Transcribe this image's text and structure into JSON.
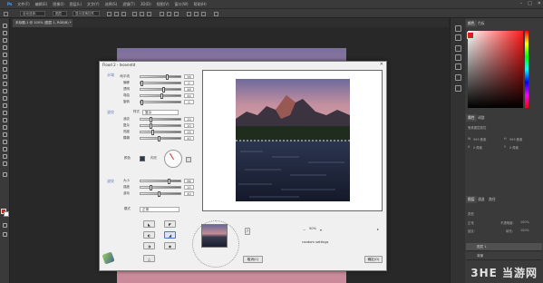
{
  "menubar": {
    "items": [
      "文件(F)",
      "编辑(E)",
      "图像(I)",
      "图层(L)",
      "文字(Y)",
      "选择(S)",
      "滤镜(T)",
      "3D(D)",
      "视图(V)",
      "窗口(W)",
      "帮助(H)"
    ]
  },
  "options": {
    "auto_select": "自动选择:",
    "layer_select": "图层",
    "show_transform": "显示变换控件"
  },
  "document": {
    "tab_title": "未标题-1 @ 100% (图层 1, RGB/8) *"
  },
  "dialog": {
    "title": "Flood 2 - Inoventd",
    "section_horizon": "水域",
    "section_waves": "波纹",
    "section_ripple": "波纹",
    "params_top": [
      {
        "label": "地平线",
        "value": "56"
      },
      {
        "label": "偏移",
        "value": "0"
      },
      {
        "label": "透明",
        "value": "46"
      },
      {
        "label": "弯曲",
        "value": "44"
      },
      {
        "label": "旋转",
        "value": "0"
      }
    ],
    "waves_mode_label": "样式",
    "waves_mode_value": "复杂",
    "params_waves": [
      {
        "label": "波纹",
        "value": "20"
      },
      {
        "label": "复杂",
        "value": "20"
      },
      {
        "label": "亮度",
        "value": "25"
      },
      {
        "label": "模糊",
        "value": "40"
      }
    ],
    "color_label": "颜色",
    "glow_label": "闪光",
    "params_ripple": [
      {
        "label": "大小",
        "value": "66"
      },
      {
        "label": "强度",
        "value": "20"
      },
      {
        "label": "波动",
        "value": "40"
      }
    ],
    "mode2_label": "模式",
    "mode2_value": "正常",
    "help_label": "?",
    "zoom_value": "50%",
    "random_settings": "random settings",
    "cancel": "取消(C)",
    "ok": "确定(O)"
  },
  "right_panel": {
    "tab_color": "颜色",
    "tab_swatches": "色板",
    "tab_properties": "属性",
    "tab_adjust": "调整",
    "props_title": "像素图层属性",
    "w_label": "W",
    "w_value": "999 像素",
    "h_label": "H",
    "h_value": "999 像素",
    "x_label": "X",
    "x_value": "0 像素",
    "y_label": "Y",
    "y_value": "0 像素",
    "tab_layers": "图层",
    "tab_channels": "通道",
    "tab_paths": "路径",
    "kind_label": "类型",
    "blend_mode": "正常",
    "opacity_label": "不透明度:",
    "opacity_value": "100%",
    "lock_label": "锁定:",
    "fill_label": "填充:",
    "fill_value": "100%",
    "layer1": "图层 1",
    "layer0": "背景"
  },
  "watermark": "3HE 当游网",
  "colors": {
    "foreground": "#d9211c",
    "background": "#ffffff",
    "accent": "#4a74c9"
  }
}
